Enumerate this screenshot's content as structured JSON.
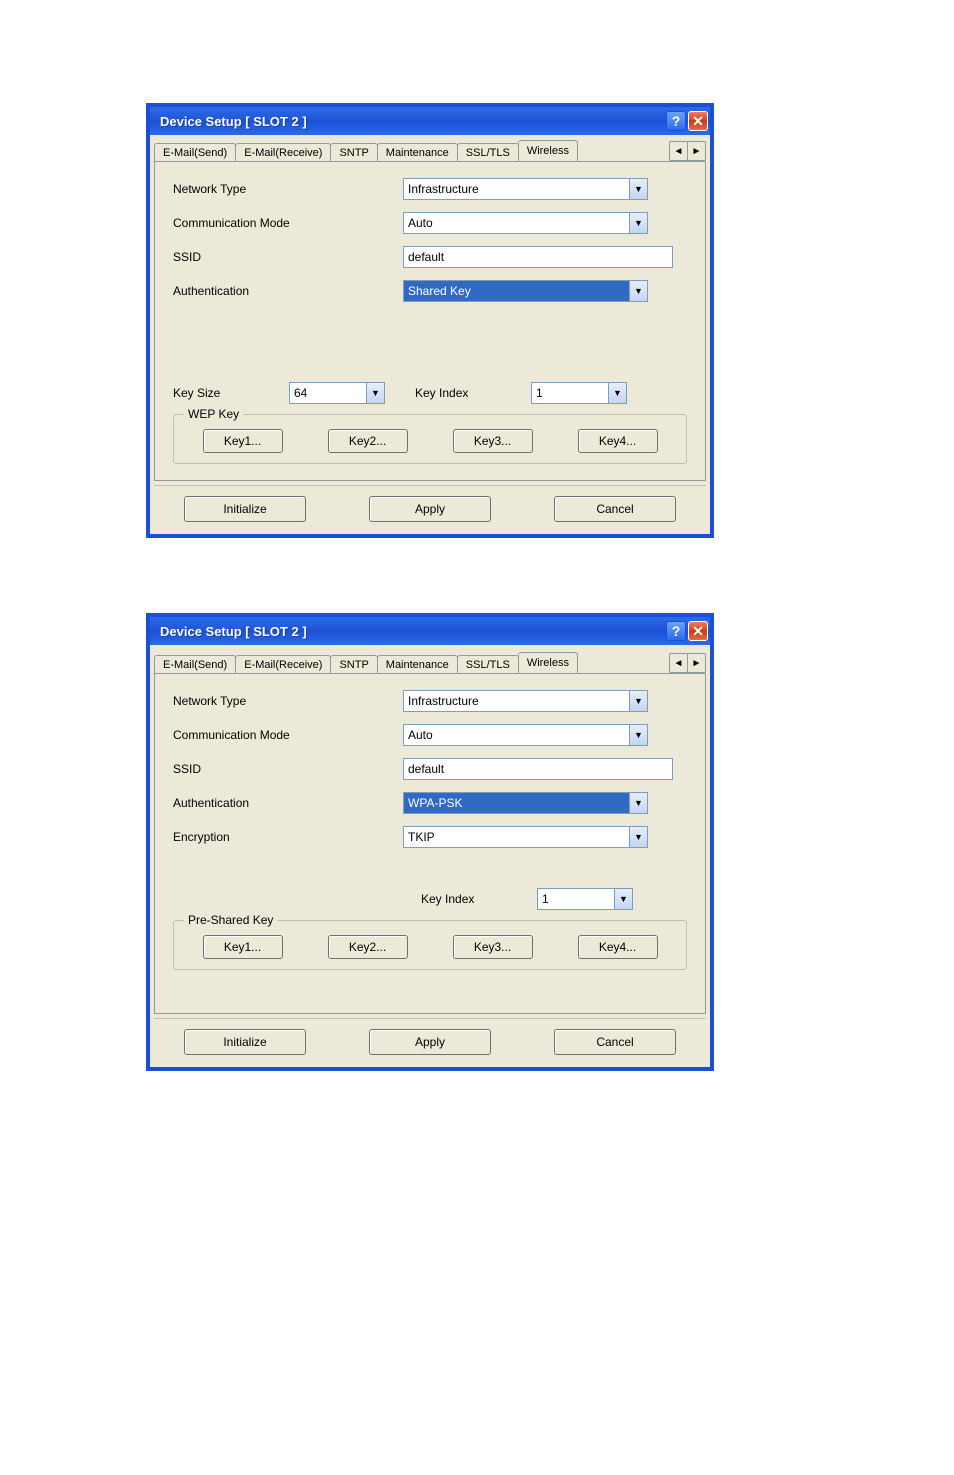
{
  "dialog1": {
    "title": "Device Setup [ SLOT 2 ]",
    "tabs": [
      "E-Mail(Send)",
      "E-Mail(Receive)",
      "SNTP",
      "Maintenance",
      "SSL/TLS",
      "Wireless"
    ],
    "active_tab": "Wireless",
    "fields": {
      "network_type_label": "Network Type",
      "network_type_value": "Infrastructure",
      "comm_mode_label": "Communication Mode",
      "comm_mode_value": "Auto",
      "ssid_label": "SSID",
      "ssid_value": "default",
      "auth_label": "Authentication",
      "auth_value": "Shared Key",
      "key_size_label": "Key Size",
      "key_size_value": "64",
      "key_index_label": "Key Index",
      "key_index_value": "1"
    },
    "group_title": "WEP Key",
    "keys": [
      "Key1...",
      "Key2...",
      "Key3...",
      "Key4..."
    ],
    "buttons": {
      "init": "Initialize",
      "apply": "Apply",
      "cancel": "Cancel"
    }
  },
  "dialog2": {
    "title": "Device Setup [ SLOT 2 ]",
    "tabs": [
      "E-Mail(Send)",
      "E-Mail(Receive)",
      "SNTP",
      "Maintenance",
      "SSL/TLS",
      "Wireless"
    ],
    "active_tab": "Wireless",
    "fields": {
      "network_type_label": "Network Type",
      "network_type_value": "Infrastructure",
      "comm_mode_label": "Communication Mode",
      "comm_mode_value": "Auto",
      "ssid_label": "SSID",
      "ssid_value": "default",
      "auth_label": "Authentication",
      "auth_value": "WPA-PSK",
      "encryption_label": "Encryption",
      "encryption_value": "TKIP",
      "key_index_label": "Key Index",
      "key_index_value": "1"
    },
    "group_title": "Pre-Shared Key",
    "keys": [
      "Key1...",
      "Key2...",
      "Key3...",
      "Key4..."
    ],
    "buttons": {
      "init": "Initialize",
      "apply": "Apply",
      "cancel": "Cancel"
    }
  }
}
